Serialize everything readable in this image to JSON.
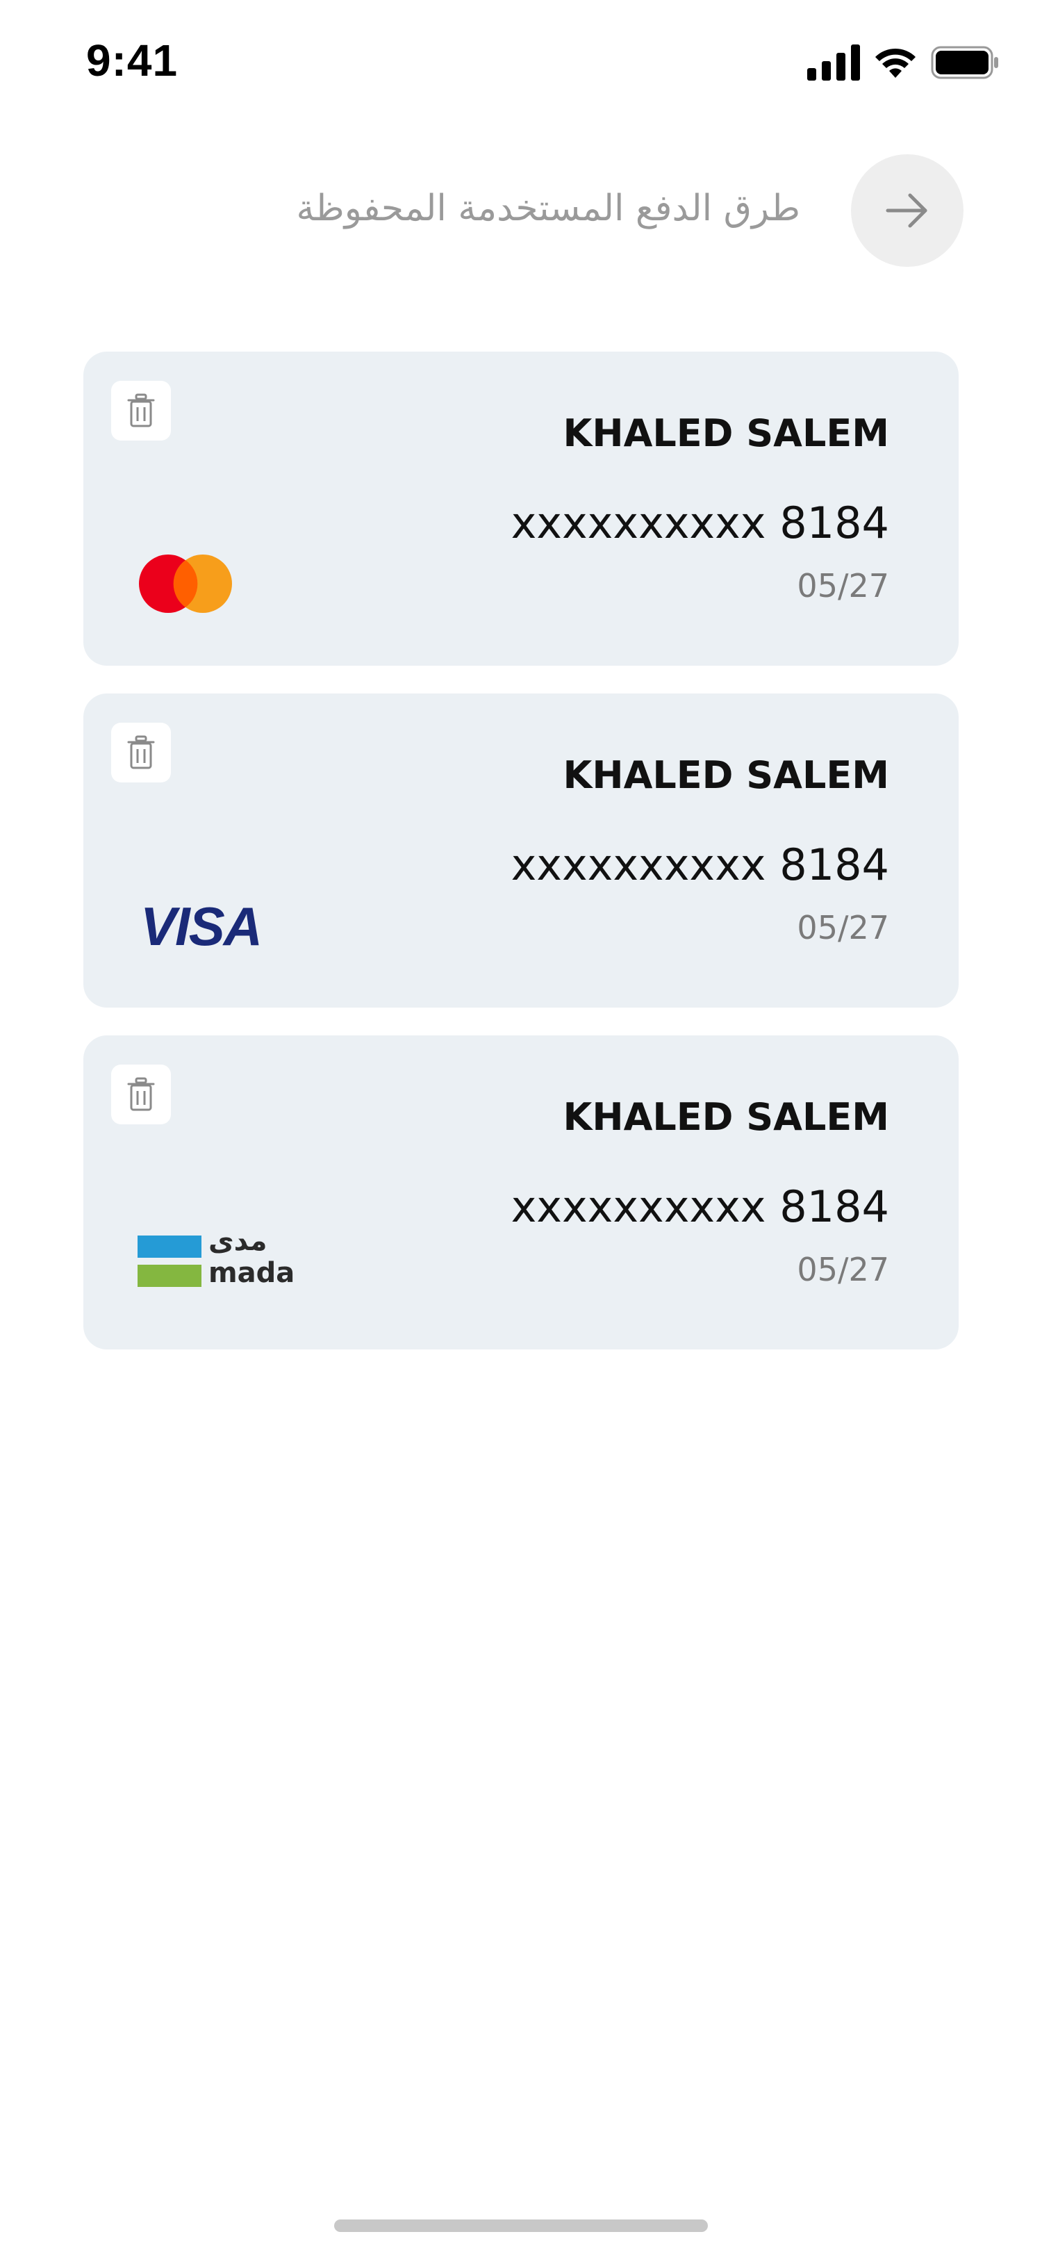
{
  "status_bar": {
    "time": "9:41"
  },
  "header": {
    "title": "طرق الدفع المستخدمة المحفوظة",
    "back_icon": "arrow-right-icon"
  },
  "cards": [
    {
      "holder": "KHALED SALEM",
      "number": "xxxxxxxxxx 8184",
      "expiry": "05/27",
      "brand": "mastercard"
    },
    {
      "holder": "KHALED SALEM",
      "number": "xxxxxxxxxx 8184",
      "expiry": "05/27",
      "brand": "visa",
      "brand_text": "VISA"
    },
    {
      "holder": "KHALED SALEM",
      "number": "xxxxxxxxxx 8184",
      "expiry": "05/27",
      "brand": "mada",
      "brand_text_arabic": "مدى",
      "brand_text": "mada"
    }
  ],
  "colors": {
    "card_background": "#ebf0f4",
    "title_text": "#9a9a9a",
    "expiry_text": "#7a7a7a",
    "visa_blue": "#1a2a78",
    "mastercard_red": "#eb001b",
    "mastercard_orange": "#f79e1b",
    "mada_blue": "#259bd6",
    "mada_green": "#84b740"
  }
}
